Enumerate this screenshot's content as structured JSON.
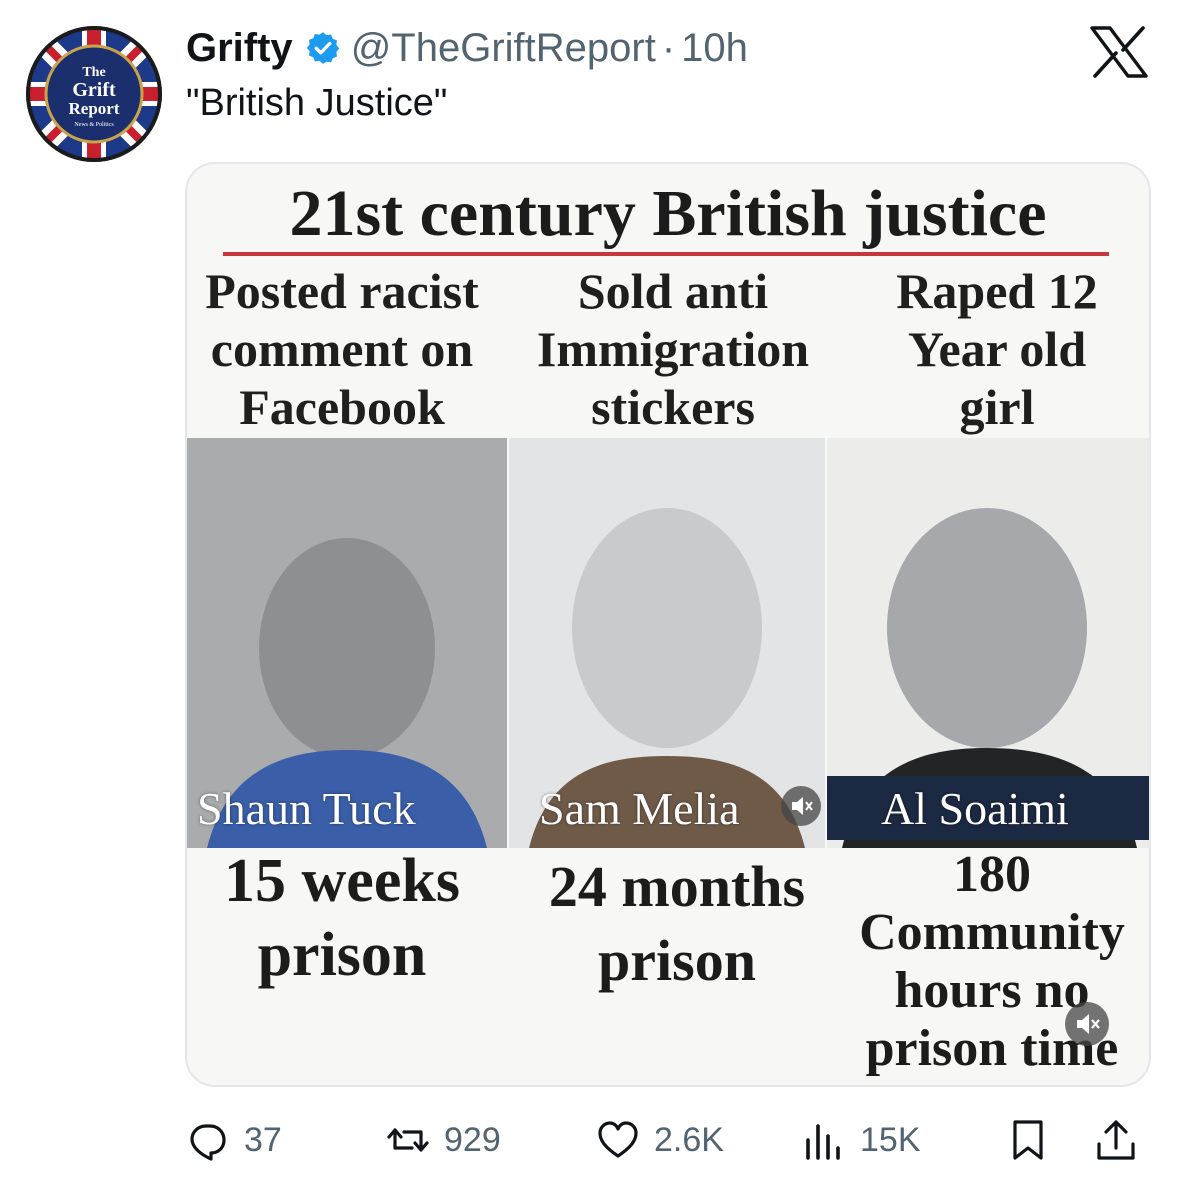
{
  "account": {
    "avatar_text": [
      "The",
      "Grift",
      "Report",
      "News & Politics"
    ],
    "author": "Grifty",
    "handle": "@TheGriftReport",
    "separator": "·",
    "time": "10h",
    "verified_color": "#1d9bf0"
  },
  "tweet": {
    "text": "\"British Justice\""
  },
  "card": {
    "title": "21st century British justice",
    "columns": [
      {
        "header": [
          "Posted racist",
          "comment on",
          "Facebook"
        ],
        "name": "Shaun Tuck",
        "sentence": [
          "15 weeks",
          "prison"
        ]
      },
      {
        "header": [
          "Sold anti",
          "Immigration",
          "stickers"
        ],
        "name": "Sam Melia",
        "sentence": [
          "24 months",
          "prison"
        ]
      },
      {
        "header": [
          "Raped 12",
          "Year old",
          "girl"
        ],
        "name": "Al Soaimi",
        "sentence": [
          "180",
          "Community",
          "hours no",
          "prison time"
        ]
      }
    ]
  },
  "actions": {
    "replies": "37",
    "reposts": "929",
    "likes": "2.6K",
    "views": "15K"
  },
  "icons": [
    "verified-badge-icon",
    "x-logo-icon",
    "mute-icon",
    "reply-icon",
    "repost-icon",
    "like-icon",
    "views-icon",
    "bookmark-icon",
    "share-icon"
  ],
  "colors": {
    "text": "#0f1419",
    "secondary": "#536471",
    "accent_rule": "#c4383c"
  }
}
